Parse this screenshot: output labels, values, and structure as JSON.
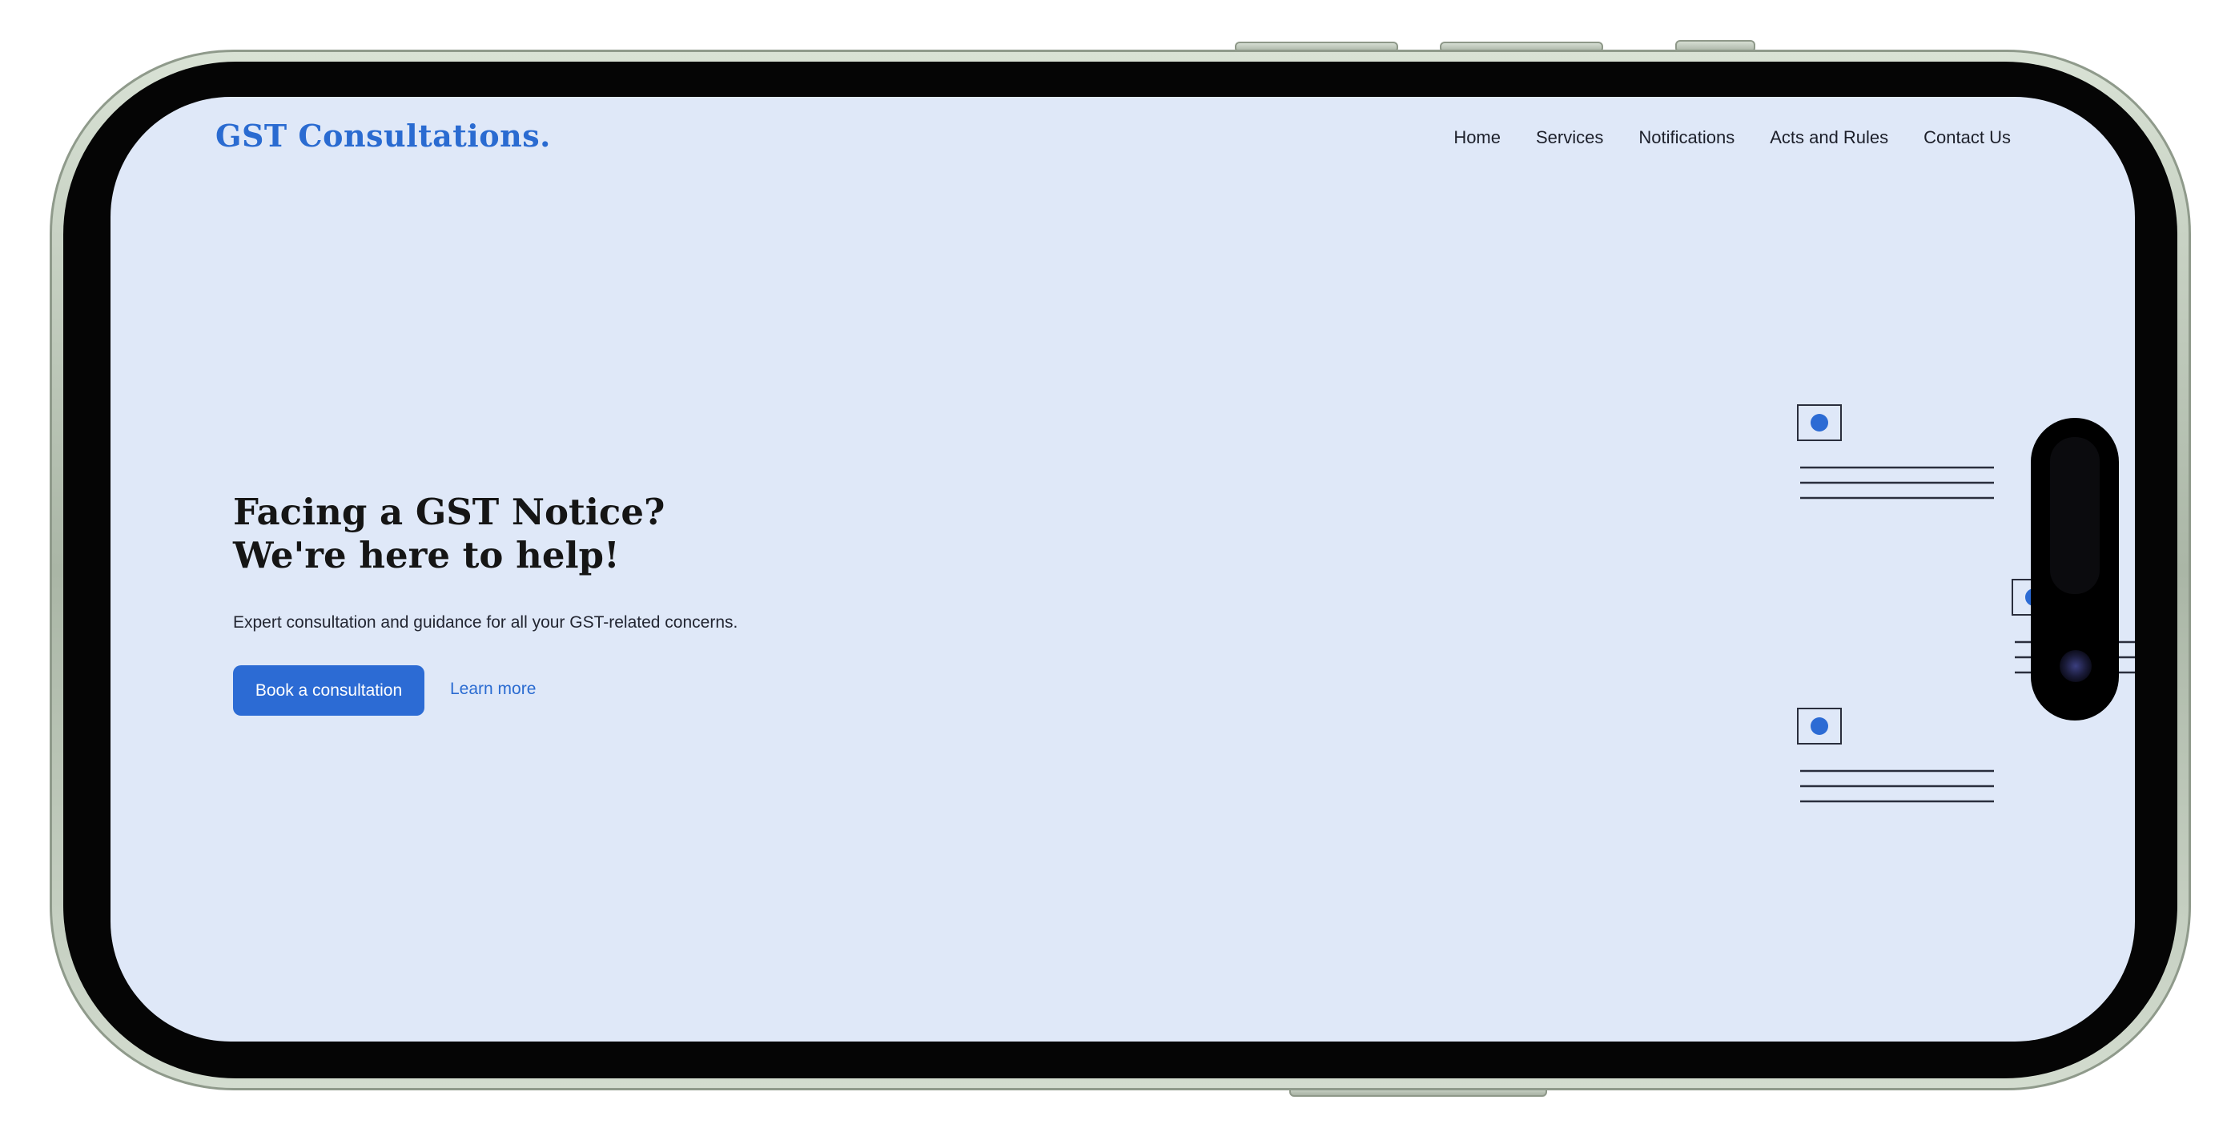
{
  "site": {
    "logo": "GST Consultations."
  },
  "nav": {
    "items": [
      {
        "label": "Home"
      },
      {
        "label": "Services"
      },
      {
        "label": "Notifications"
      },
      {
        "label": "Acts and Rules"
      },
      {
        "label": "Contact Us"
      }
    ]
  },
  "hero": {
    "title_line1": "Facing a GST Notice?",
    "title_line2": "We're here to help!",
    "subtitle": "Expert consultation and guidance for all your GST-related concerns.",
    "primary_cta": "Book a consultation",
    "secondary_cta": "Learn more"
  },
  "colors": {
    "accent": "#2c6bd4",
    "page_background": "#dfe8f8",
    "text": "#151515",
    "device_frame": "#b8c4b4"
  },
  "icons": {
    "illustration": "document-notice-cards"
  }
}
